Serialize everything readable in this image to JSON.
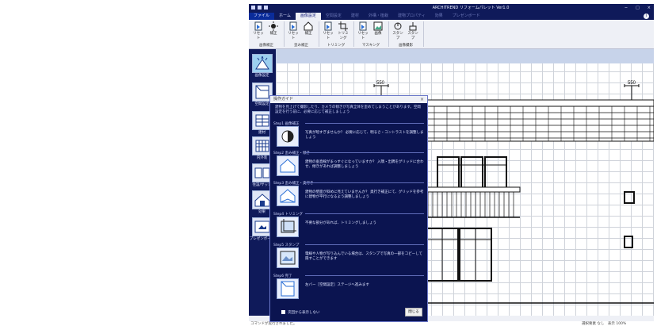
{
  "window": {
    "title": "ARCHITREND リフォームパレット Ver1.0",
    "min": "−",
    "max": "□",
    "close": "×"
  },
  "tabs": [
    {
      "label": "ファイル",
      "state": "file"
    },
    {
      "label": "ホーム",
      "state": "normal"
    },
    {
      "label": "画像設定",
      "state": "active"
    },
    {
      "label": "空間設定",
      "state": "dim"
    },
    {
      "label": "建材",
      "state": "dim"
    },
    {
      "label": "外構・植栽",
      "state": "dim"
    },
    {
      "label": "建物プロパティ",
      "state": "dim"
    },
    {
      "label": "効果",
      "state": "dim"
    },
    {
      "label": "プレゼンボード",
      "state": "dim"
    }
  ],
  "help": "i",
  "ribbon": {
    "groups": [
      {
        "label": "画像補正",
        "buttons": [
          {
            "label": "リセット",
            "icon": "reset-icon"
          },
          {
            "label": "補正",
            "icon": "adjust-icon"
          }
        ]
      },
      {
        "label": "歪み補正",
        "buttons": [
          {
            "label": "リセット",
            "icon": "reset-icon"
          },
          {
            "label": "補正",
            "icon": "distortion-icon"
          }
        ]
      },
      {
        "label": "トリミング",
        "buttons": [
          {
            "label": "リセット",
            "icon": "reset-icon"
          },
          {
            "label": "トリミング",
            "icon": "crop-icon"
          }
        ]
      },
      {
        "label": "マスキング",
        "buttons": [
          {
            "label": "リセット",
            "icon": "reset-icon"
          },
          {
            "label": "画像",
            "icon": "mask-icon"
          }
        ]
      },
      {
        "label": "画像撮影",
        "buttons": [
          {
            "label": "スタンプ",
            "icon": "stamp-icon"
          },
          {
            "label": "スタンプ",
            "icon": "stamp2-icon"
          }
        ]
      }
    ]
  },
  "sidebar": [
    {
      "label": "画像設定",
      "icon": "image-settings-icon",
      "active": true
    },
    {
      "label": "空間設定",
      "icon": "space-settings-icon",
      "active": false
    },
    {
      "label": "建材",
      "icon": "material-icon",
      "active": false
    },
    {
      "label": "内外装",
      "icon": "interior-exterior-icon",
      "active": false
    },
    {
      "label": "住設/サッシ",
      "icon": "equipment-icon",
      "active": false
    },
    {
      "label": "効果",
      "icon": "effect-icon",
      "active": false
    },
    {
      "label": "プレゼンボード",
      "icon": "presentation-board-icon",
      "active": false
    }
  ],
  "canvas": {
    "dimension_labels": [
      "550",
      "550"
    ]
  },
  "dialog": {
    "title": "操作ガイド",
    "close": "×",
    "intro": "建物を見上げて撮影したり、カメラの傾きが写真全体を歪めてしまうことがあります。空間設定を行う前に、必要に応じて補正しましょう",
    "steps": [
      {
        "head": "Step1  画像補正",
        "text": "写真が暗すぎませんか？ 必要に応じて、明るさ・コントラストを調整しましょう",
        "icon": "brightness-icon"
      },
      {
        "head": "Step2  歪み補正・傾き",
        "text": "建物の垂直線がまっすぐになっていますか？ 入隅・出隅をグリッドに合わせ、傾きがあれば調整しましょう",
        "icon": "tilt-icon"
      },
      {
        "head": "Step3  歪み補正・奥行き",
        "text": "建物の壁面が斜めに見えていませんか？ 奥行き補正にて、グリッドを参考に建物が平行になるよう調整しましょう",
        "icon": "depth-icon"
      },
      {
        "head": "Step4  トリミング",
        "text": "不要な部分があれば、トリミングしましょう",
        "icon": "trimming-icon"
      },
      {
        "head": "Step5  スタンプ",
        "text": "電線や人物が写り込んでいる場合は、スタンプで写真の一部をコピーして隠すことができます",
        "icon": "stamp-step-icon"
      },
      {
        "head": "Step6  完了",
        "text": "左バー［空間設定］ステージへ進みます",
        "icon": "complete-icon"
      }
    ],
    "checkbox_label": "次回から表示しない",
    "close_button": "閉じる"
  },
  "status": {
    "left": "コマンドが実行されました。",
    "right": "選択要素 なし　表示 100%"
  }
}
